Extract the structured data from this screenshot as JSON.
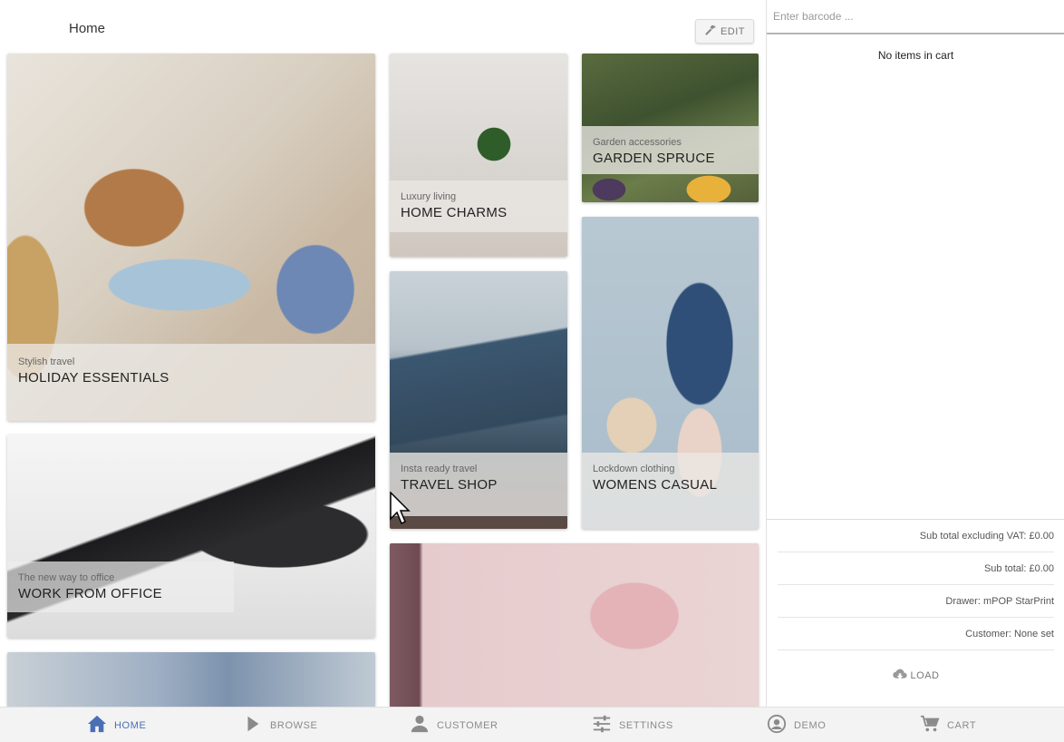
{
  "header": {
    "title": "Home",
    "edit_label": "EDIT"
  },
  "tiles": [
    {
      "subtitle": "Stylish travel",
      "title": "HOLIDAY ESSENTIALS"
    },
    {
      "subtitle": "Luxury living",
      "title": "HOME CHARMS"
    },
    {
      "subtitle": "Garden accessories",
      "title": "GARDEN SPRUCE"
    },
    {
      "subtitle": "Insta ready travel",
      "title": "TRAVEL SHOP"
    },
    {
      "subtitle": "Lockdown clothing",
      "title": "WOMENS CASUAL"
    },
    {
      "subtitle": "The new way to office",
      "title": "WORK FROM OFFICE"
    }
  ],
  "cart": {
    "barcode_placeholder": "Enter barcode ...",
    "empty_message": "No items in cart",
    "subtotal_ex_vat": "Sub total excluding VAT: £0.00",
    "subtotal": "Sub total: £0.00",
    "drawer": "Drawer: mPOP StarPrint",
    "customer": "Customer: None set",
    "load_label": "LOAD"
  },
  "nav": {
    "items": [
      {
        "label": "HOME",
        "icon": "home-icon",
        "active": true
      },
      {
        "label": "BROWSE",
        "icon": "play-arrow-icon",
        "active": false
      },
      {
        "label": "CUSTOMER",
        "icon": "person-icon",
        "active": false
      },
      {
        "label": "SETTINGS",
        "icon": "sliders-icon",
        "active": false
      },
      {
        "label": "DEMO",
        "icon": "account-circle-icon",
        "active": false
      },
      {
        "label": "CART",
        "icon": "cart-icon",
        "active": false
      }
    ]
  },
  "colors": {
    "accent": "#4a6fb5",
    "nav_background": "#f3f3f3",
    "tile_overlay": "#ebe8e4"
  }
}
